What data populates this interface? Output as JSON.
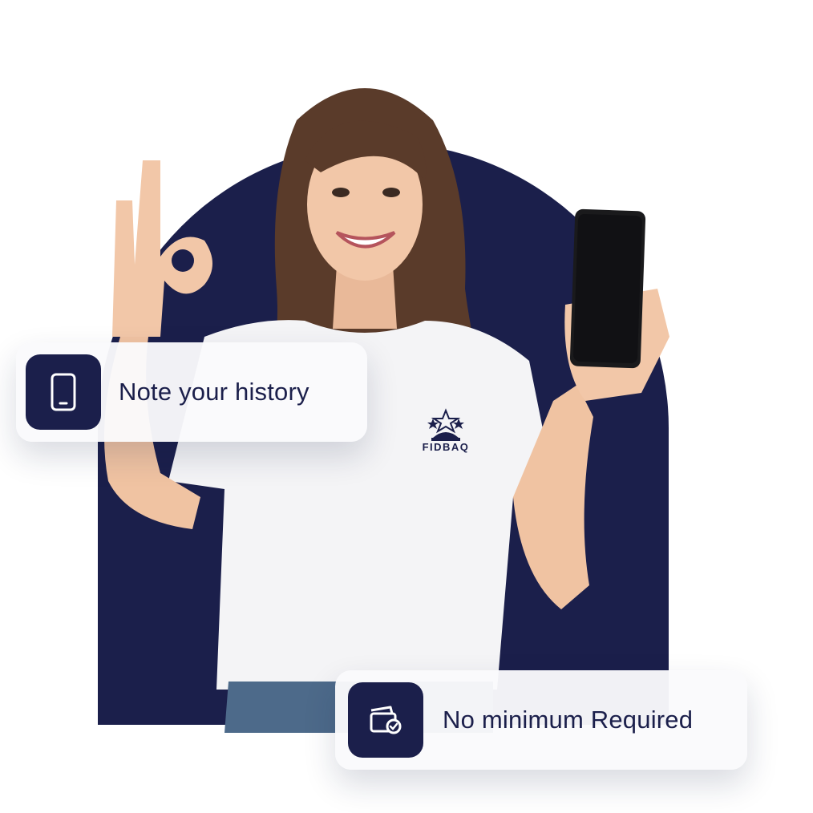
{
  "colors": {
    "navy": "#1b1f4b",
    "card_bg": "#fafafc",
    "page_bg": "#ffffff",
    "shirt": "#f4f4f6",
    "skin": "#f2c7a8",
    "hair": "#5a3b2a",
    "phone": "#1a1a1c"
  },
  "shirt_logo": {
    "text": "FIDBAQ",
    "icon": "trophy-stars-icon"
  },
  "features": [
    {
      "label": "Note your history",
      "icon": "smartphone-icon"
    },
    {
      "label": "No minimum Required",
      "icon": "wallet-cards-icon"
    }
  ]
}
